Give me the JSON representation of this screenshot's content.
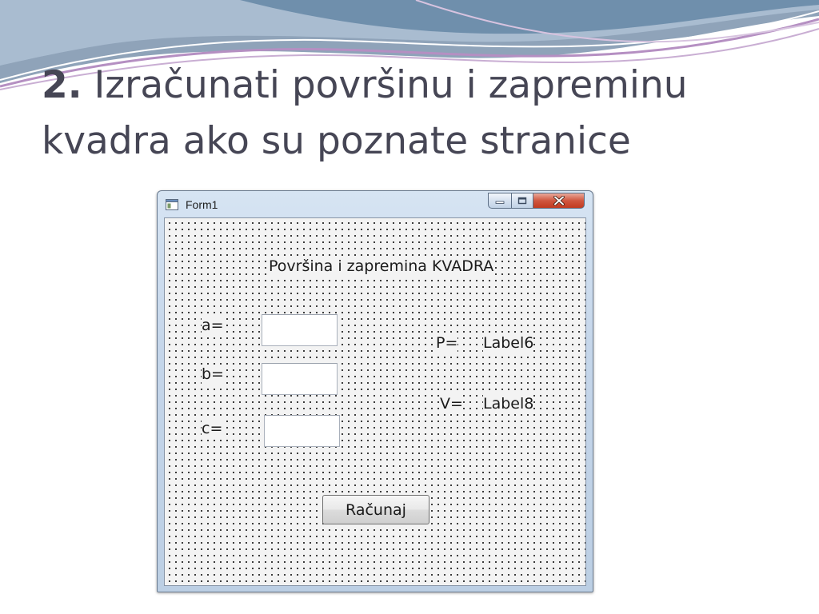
{
  "slide": {
    "title_number": "2.",
    "title_text": "Izračunati površinu i zapreminu kvadra ako su poznate stranice"
  },
  "window": {
    "title": "Form1",
    "controls": {
      "minimize_glyph": "–",
      "maximize_glyph": "□",
      "close_glyph": "✕"
    }
  },
  "form": {
    "heading": "Površina i zapremina KVADRA",
    "label_a": "a=",
    "label_b": "b=",
    "label_c": "c=",
    "input_a_value": "",
    "input_b_value": "",
    "input_c_value": "",
    "label_p": "P=",
    "result_p": "Label6",
    "label_v": "V=",
    "result_v": "Label8",
    "button_label": "Računaj"
  },
  "colors": {
    "title_text": "#464655",
    "close_button": "#c23a20",
    "form_background": "#f3f3f3",
    "title_bar": "#c5d6ea"
  },
  "icons": [
    "app-icon",
    "minimize-icon",
    "maximize-icon",
    "close-icon"
  ]
}
